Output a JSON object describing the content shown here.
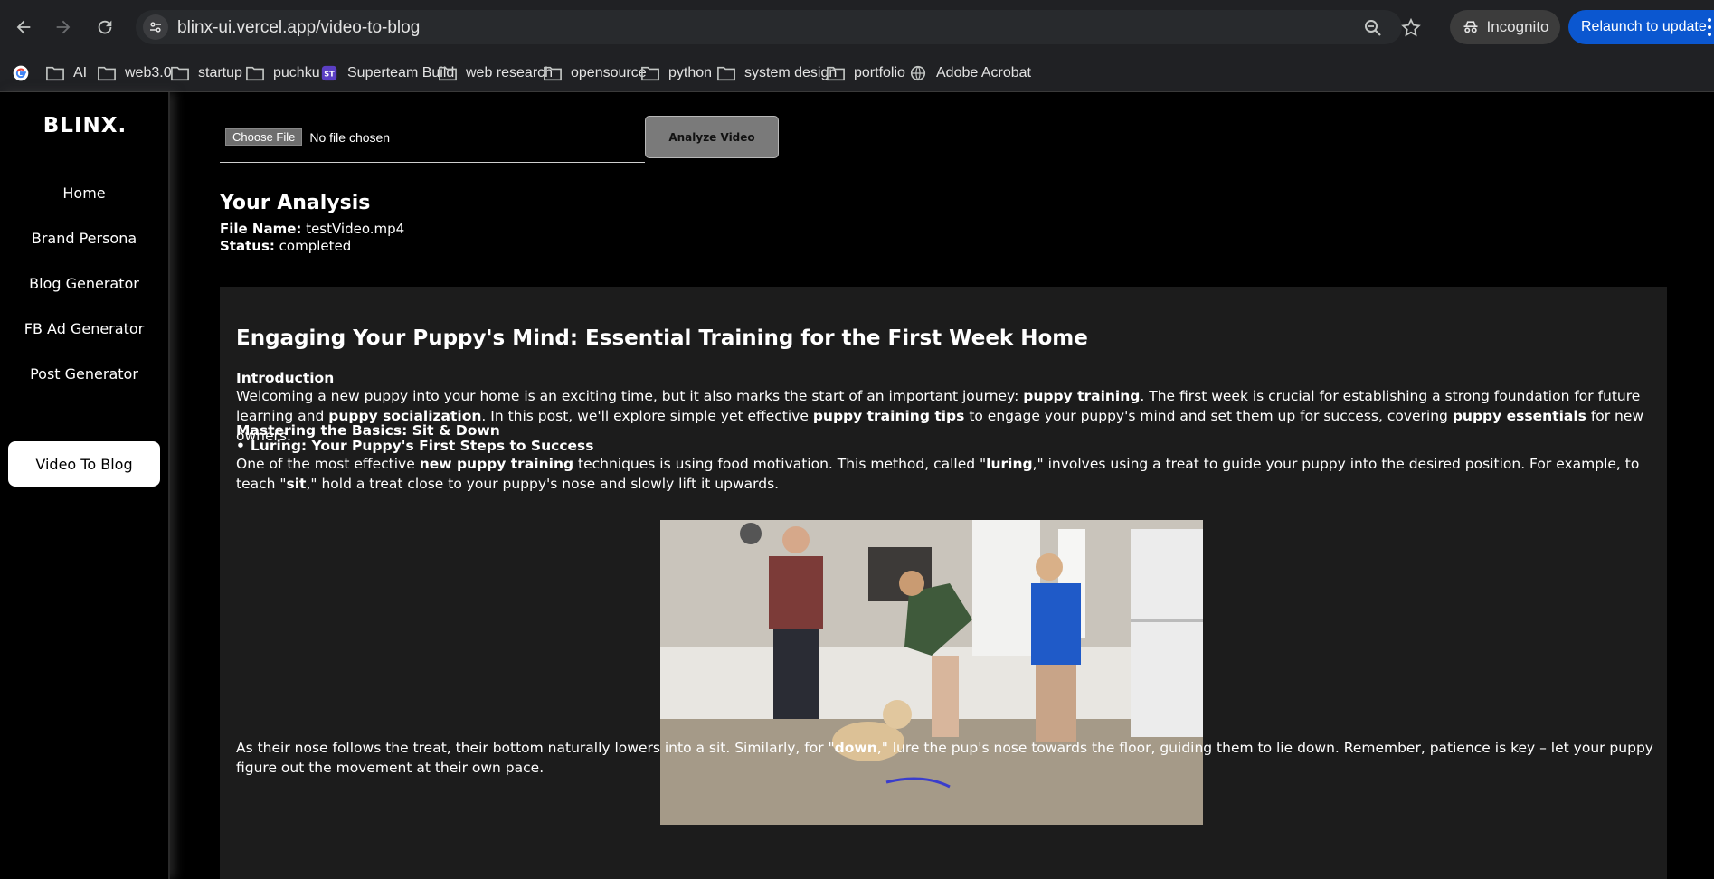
{
  "browser": {
    "url": "blinx-ui.vercel.app/video-to-blog",
    "incognito_label": "Incognito",
    "relaunch_label": "Relaunch to update",
    "bookmarks": [
      {
        "label": "AI",
        "icon": "folder-icon"
      },
      {
        "label": "web3.0",
        "icon": "folder-icon"
      },
      {
        "label": "startup",
        "icon": "folder-icon"
      },
      {
        "label": "puchku",
        "icon": "folder-icon"
      },
      {
        "label": "Superteam Build",
        "icon": "superteam-icon"
      },
      {
        "label": "web research",
        "icon": "folder-icon"
      },
      {
        "label": "opensource",
        "icon": "folder-icon"
      },
      {
        "label": "python",
        "icon": "folder-icon"
      },
      {
        "label": "system design",
        "icon": "folder-icon"
      },
      {
        "label": "portfolio",
        "icon": "folder-icon"
      },
      {
        "label": "Adobe Acrobat",
        "icon": "globe-icon"
      }
    ]
  },
  "sidebar": {
    "logo": "BLINX.",
    "items": [
      {
        "label": "Home"
      },
      {
        "label": "Brand Persona"
      },
      {
        "label": "Blog Generator"
      },
      {
        "label": "FB Ad Generator"
      },
      {
        "label": "Post Generator"
      },
      {
        "label": "Video To Blog",
        "active": true
      }
    ]
  },
  "upload": {
    "choose_label": "Choose File",
    "no_file_label": "No file chosen",
    "analyze_label": "Analyze Video"
  },
  "analysis": {
    "title": "Your Analysis",
    "file_name_label": "File Name:",
    "file_name": "testVideo.mp4",
    "status_label": "Status:",
    "status": "completed"
  },
  "blog": {
    "title": "Engaging Your Puppy's Mind: Essential Training for the First Week Home",
    "intro_heading": "Introduction",
    "intro": [
      {
        "t": "Welcoming a new puppy into your home is an exciting time, but it also marks the start of an important journey: "
      },
      {
        "t": "puppy training",
        "b": true
      },
      {
        "t": ". The first week is crucial for establishing a strong foundation for future learning and "
      },
      {
        "t": "puppy socialization",
        "b": true
      },
      {
        "t": ". In this post, we'll explore simple yet effective "
      },
      {
        "t": "puppy training tips",
        "b": true
      },
      {
        "t": " to engage your puppy's mind and set them up for success, covering "
      },
      {
        "t": "puppy essentials",
        "b": true
      },
      {
        "t": " for new owners."
      }
    ],
    "section_heading": "Mastering the Basics: Sit & Down",
    "bullet": "Luring: Your Puppy's First Steps to Success",
    "luring": [
      {
        "t": "One of the most effective "
      },
      {
        "t": "new puppy training",
        "b": true
      },
      {
        "t": " techniques is using food motivation. This method, called \""
      },
      {
        "t": "luring",
        "b": true
      },
      {
        "t": ",\" involves using a treat to guide your puppy into the desired position. For example, to teach \""
      },
      {
        "t": "sit",
        "b": true
      },
      {
        "t": ",\" hold a treat close to your puppy's nose and slowly lift it upwards."
      }
    ],
    "after_image": [
      {
        "t": "As their nose follows the treat, their bottom naturally lowers into a sit. Similarly, for \""
      },
      {
        "t": "down",
        "b": true
      },
      {
        "t": ",\" lure the pup's nose towards the floor, guiding them to lie down. Remember, patience is key – let your puppy figure out the movement at their own pace."
      }
    ]
  }
}
